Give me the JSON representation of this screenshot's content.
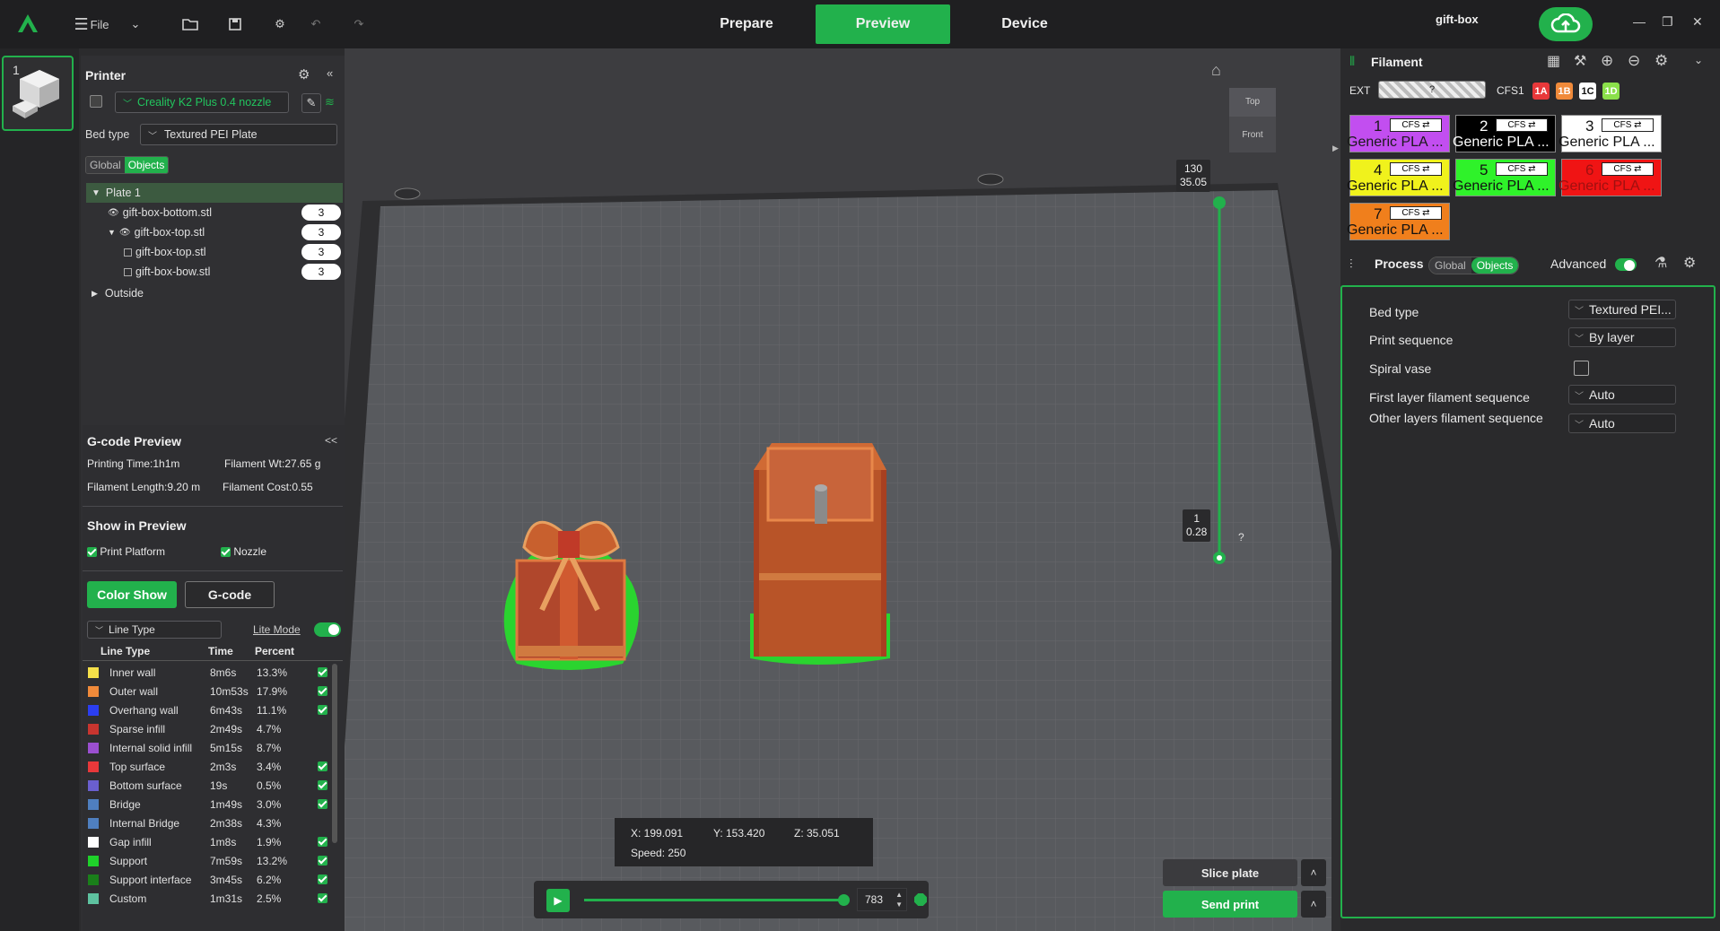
{
  "topbar": {
    "file_label": "File",
    "tabs": [
      {
        "label": "Prepare",
        "active": false
      },
      {
        "label": "Preview",
        "active": true
      },
      {
        "label": "Device",
        "active": false
      }
    ],
    "project_name": "gift-box"
  },
  "plates": [
    {
      "number": "1"
    }
  ],
  "printer": {
    "title": "Printer",
    "name": "Creality K2 Plus 0.4 nozzle",
    "bed_type_label": "Bed type",
    "bed_type_value": "Textured PEI Plate",
    "seg_global": "Global",
    "seg_objects": "Objects"
  },
  "tree": {
    "plate": "Plate 1",
    "items": [
      {
        "name": "gift-box-bottom.stl",
        "count": "3"
      },
      {
        "name": "gift-box-top.stl",
        "count": "3"
      },
      {
        "name": "gift-box-top.stl",
        "count": "3"
      },
      {
        "name": "gift-box-bow.stl",
        "count": "3"
      }
    ],
    "outside": "Outside"
  },
  "gcode_preview": {
    "title": "G-code Preview",
    "collapse": "<<",
    "printing_time": "Printing Time:1h1m",
    "filament_wt": "Filament Wt:27.65 g",
    "filament_length": "Filament Length:9.20 m",
    "filament_cost": "Filament Cost:0.55",
    "show_title": "Show in Preview",
    "print_platform": "Print Platform",
    "nozzle": "Nozzle",
    "color_show": "Color Show",
    "gcode_btn": "G-code",
    "line_type_combo": "Line Type",
    "lite_mode": "Lite Mode",
    "headers": [
      "Line Type",
      "Time",
      "Percent"
    ],
    "rows": [
      {
        "name": "Inner wall",
        "time": "8m6s",
        "percent": "13.3%",
        "color": "#f5e04a",
        "checked": true
      },
      {
        "name": "Outer wall",
        "time": "10m53s",
        "percent": "17.9%",
        "color": "#f08a3a",
        "checked": true
      },
      {
        "name": "Overhang wall",
        "time": "6m43s",
        "percent": "11.1%",
        "color": "#2b3ef0",
        "checked": true
      },
      {
        "name": "Sparse infill",
        "time": "2m49s",
        "percent": "4.7%",
        "color": "#c8352f",
        "checked": false
      },
      {
        "name": "Internal solid infill",
        "time": "5m15s",
        "percent": "8.7%",
        "color": "#9b4fd0",
        "checked": false
      },
      {
        "name": "Top surface",
        "time": "2m3s",
        "percent": "3.4%",
        "color": "#e8383a",
        "checked": true
      },
      {
        "name": "Bottom surface",
        "time": "19s",
        "percent": "0.5%",
        "color": "#6a5fcf",
        "checked": true
      },
      {
        "name": "Bridge",
        "time": "1m49s",
        "percent": "3.0%",
        "color": "#4f7fbf",
        "checked": true
      },
      {
        "name": "Internal Bridge",
        "time": "2m38s",
        "percent": "4.3%",
        "color": "#4f7fbf",
        "checked": false
      },
      {
        "name": "Gap infill",
        "time": "1m8s",
        "percent": "1.9%",
        "color": "#ffffff",
        "checked": true
      },
      {
        "name": "Support",
        "time": "7m59s",
        "percent": "13.2%",
        "color": "#1fd12a",
        "checked": true
      },
      {
        "name": "Support interface",
        "time": "3m45s",
        "percent": "6.2%",
        "color": "#1a7f1a",
        "checked": true
      },
      {
        "name": "Custom",
        "time": "1m31s",
        "percent": "2.5%",
        "color": "#5ec2a0",
        "checked": true
      }
    ]
  },
  "viewport": {
    "view_top": "Top",
    "view_front": "Front",
    "layer_top_num": "130",
    "layer_top_height": "35.05",
    "layer_bottom_num": "1",
    "layer_bottom_height": "0.28",
    "help": "?",
    "coord_x": "X: 199.091",
    "coord_y": "Y: 153.420",
    "coord_z": "Z: 35.051",
    "speed": "Speed: 250",
    "move_value": "783",
    "progress": 1.0,
    "slice_plate": "Slice plate",
    "send_print": "Send print"
  },
  "filament": {
    "title": "Filament",
    "ext_label": "EXT",
    "ext_value": "?",
    "cfs_label": "CFS1",
    "chips": [
      {
        "label": "1A",
        "color": "#e8383a"
      },
      {
        "label": "1B",
        "color": "#f08a3a"
      },
      {
        "label": "1C",
        "color": "#ffffff"
      },
      {
        "label": "1D",
        "color": "#8be04a"
      }
    ],
    "slots": [
      {
        "num": "1",
        "cfs": "CFS ⇄",
        "label": "Generic PLA ...",
        "bg": "#c24ef0",
        "fg": "#1a1a1a"
      },
      {
        "num": "2",
        "cfs": "CFS ⇄",
        "label": "Generic PLA ...",
        "bg": "#000000",
        "fg": "#ffffff"
      },
      {
        "num": "3",
        "cfs": "CFS ⇄",
        "label": "Generic PLA ...",
        "bg": "#ffffff",
        "fg": "#111111"
      },
      {
        "num": "4",
        "cfs": "CFS ⇄",
        "label": "Generic PLA ...",
        "bg": "#f0f21c",
        "fg": "#111111"
      },
      {
        "num": "5",
        "cfs": "CFS ⇄",
        "label": "Generic PLA ...",
        "bg": "#2ff22a",
        "fg": "#111111"
      },
      {
        "num": "6",
        "cfs": "CFS ⇄",
        "label": "Generic PLA ...",
        "bg": "#f01414",
        "fg": "#a01010"
      },
      {
        "num": "7",
        "cfs": "CFS ⇄",
        "label": "Generic PLA ...",
        "bg": "#f07f1c",
        "fg": "#111111"
      }
    ]
  },
  "process": {
    "title": "Process",
    "seg_global": "Global",
    "seg_objects": "Objects",
    "advanced": "Advanced",
    "rows": [
      {
        "label": "Bed type",
        "value": "Textured PEI..."
      },
      {
        "label": "Print sequence",
        "value": "By layer"
      },
      {
        "label": "Spiral vase",
        "value": ""
      },
      {
        "label": "First layer filament sequence",
        "value": "Auto"
      },
      {
        "label": "Other layers filament sequence",
        "value": "Auto"
      }
    ]
  }
}
